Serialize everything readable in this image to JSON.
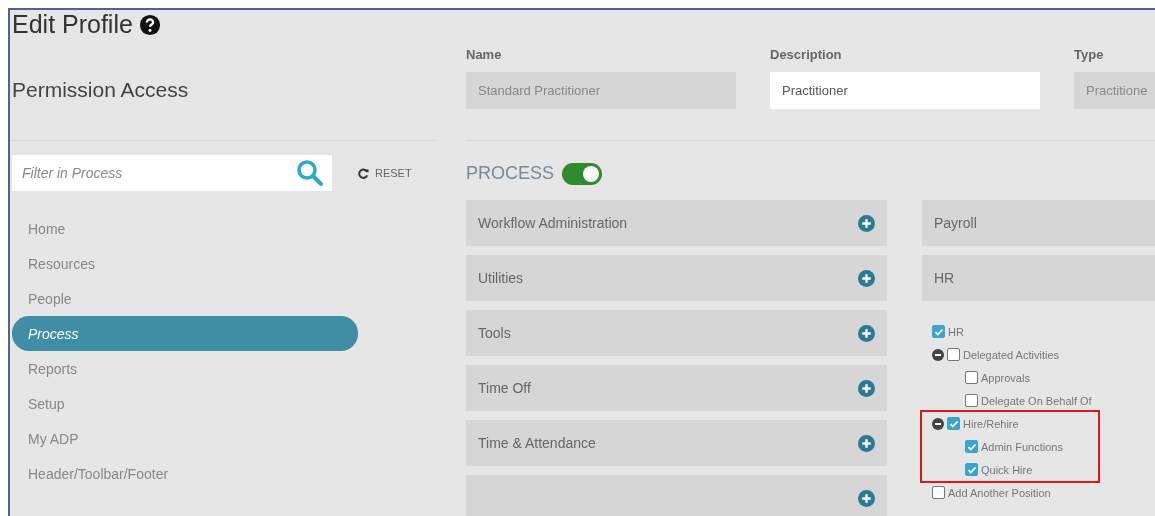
{
  "title": "Edit Profile",
  "section_title": "Permission Access",
  "filter": {
    "placeholder": "Filter in Process"
  },
  "reset": "RESET",
  "sidebar": {
    "items": [
      {
        "label": "Home",
        "selected": false
      },
      {
        "label": "Resources",
        "selected": false
      },
      {
        "label": "People",
        "selected": false
      },
      {
        "label": "Process",
        "selected": true
      },
      {
        "label": "Reports",
        "selected": false
      },
      {
        "label": "Setup",
        "selected": false
      },
      {
        "label": "My ADP",
        "selected": false
      },
      {
        "label": "Header/Toolbar/Footer",
        "selected": false
      }
    ]
  },
  "fields": [
    {
      "label": "Name",
      "value": "Standard Practitioner",
      "disabled": true
    },
    {
      "label": "Description",
      "value": "Practitioner",
      "disabled": false
    },
    {
      "label": "Type",
      "value": "Practitione",
      "disabled": true
    }
  ],
  "process": {
    "label": "PROCESS",
    "on": true
  },
  "panels": [
    {
      "kind": "panel",
      "label": "Workflow Administration"
    },
    {
      "kind": "panel",
      "label": "Utilities"
    },
    {
      "kind": "panel",
      "label": "Tools"
    },
    {
      "kind": "panel",
      "label": "Time Off"
    },
    {
      "kind": "panel",
      "label": "Time & Attendance"
    },
    {
      "kind": "partial"
    }
  ],
  "side_panels": [
    {
      "label": "Payroll"
    },
    {
      "label": "HR"
    }
  ],
  "tree": [
    {
      "label": "HR",
      "checked": true,
      "highlighted": false
    },
    {
      "label": "Delegated Activities",
      "checked": false,
      "expanded": true,
      "highlighted": false,
      "children": [
        {
          "label": "Approvals",
          "checked": false
        },
        {
          "label": "Delegate On Behalf Of",
          "checked": false
        }
      ]
    },
    {
      "label": "Hire/Rehire",
      "checked": true,
      "expanded": true,
      "highlighted": true,
      "children": [
        {
          "label": "Admin Functions",
          "checked": true
        },
        {
          "label": "Quick Hire",
          "checked": true
        }
      ]
    },
    {
      "label": "Add Another Position",
      "checked": false,
      "highlighted": false
    }
  ]
}
